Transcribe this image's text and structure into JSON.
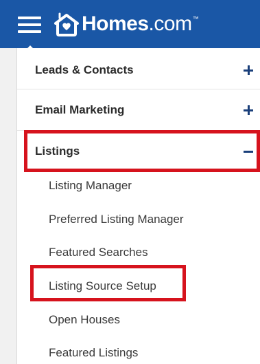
{
  "header": {
    "brand_bold": "Homes",
    "brand_light": ".com",
    "brand_tm": "™",
    "background_color": "#1a57a6"
  },
  "icons": {
    "menu": "hamburger-menu-icon",
    "logo": "homes-logo-icon",
    "expand": "plus-icon",
    "collapse": "minus-icon"
  },
  "menu": {
    "sections": [
      {
        "label": "Leads & Contacts",
        "state": "collapsed"
      },
      {
        "label": "Email Marketing",
        "state": "collapsed"
      },
      {
        "label": "Listings",
        "state": "expanded"
      }
    ],
    "listings_items": [
      {
        "label": "Listing Manager"
      },
      {
        "label": "Preferred Listing Manager"
      },
      {
        "label": "Featured Searches"
      },
      {
        "label": "Listing Source Setup"
      },
      {
        "label": "Open Houses"
      },
      {
        "label": "Featured Listings"
      }
    ]
  },
  "colors": {
    "highlight": "#d6131d",
    "toggle": "#1a3f7a",
    "text": "#2b2b2b"
  }
}
